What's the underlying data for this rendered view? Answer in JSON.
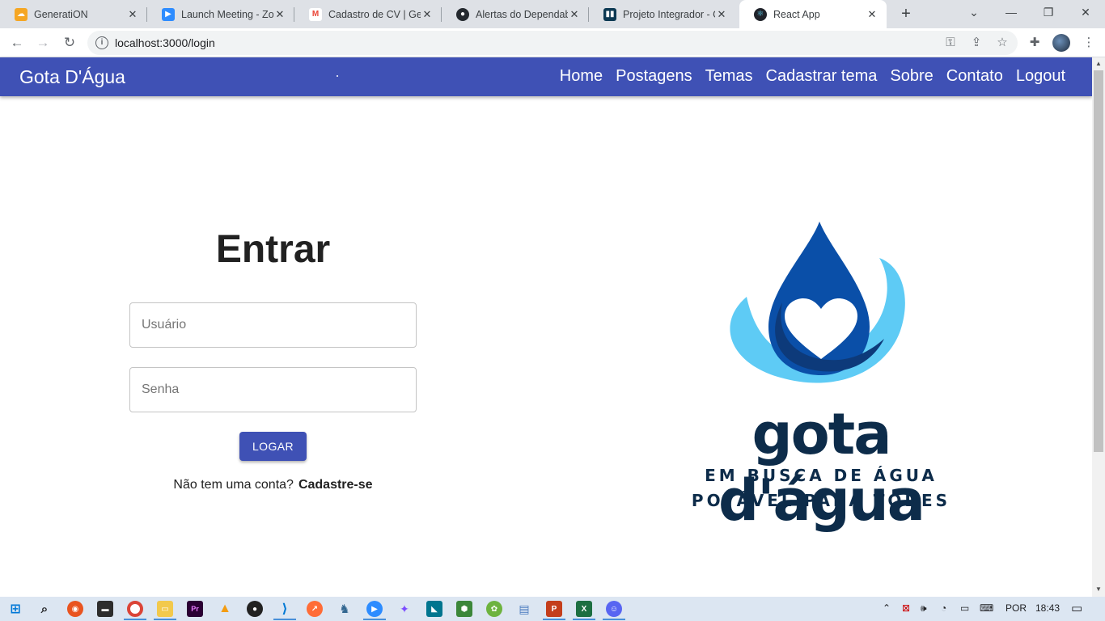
{
  "browser": {
    "tabs": [
      {
        "title": "GeneratiON",
        "icon": "cloud-icon",
        "color": "#f5a623"
      },
      {
        "title": "Launch Meeting - Zoom",
        "icon": "zoom-icon",
        "color": "#2d8cff"
      },
      {
        "title": "Cadastro de CV | GenT",
        "icon": "gmail-icon",
        "color": "#ea4335"
      },
      {
        "title": "Alertas do Dependabot",
        "icon": "github-icon",
        "color": "#24292e"
      },
      {
        "title": "Projeto Integrador - G",
        "icon": "trello-icon",
        "color": "#0079bf"
      },
      {
        "title": "React App",
        "icon": "react-icon",
        "color": "#61dafb"
      }
    ],
    "active_tab": 5,
    "url": "localhost:3000/login"
  },
  "app": {
    "brand": "Gota D'Água",
    "nav": [
      "Home",
      "Postagens",
      "Temas",
      "Cadastrar tema",
      "Sobre",
      "Contato",
      "Logout"
    ],
    "accent": "#3f51b5"
  },
  "login": {
    "title": "Entrar",
    "username_placeholder": "Usuário",
    "password_placeholder": "Senha",
    "button": "LOGAR",
    "no_account": "Não tem uma conta?",
    "signup_link": "Cadastre-se"
  },
  "logo": {
    "name": "gota d'água",
    "tagline_1": "EM BUSCA DE ÁGUA",
    "tagline_2": "POTÁVEL PARA TODES",
    "dark_color": "#0d2c4a",
    "blue_color": "#0a4fa8",
    "light_color": "#5ecbf5"
  },
  "taskbar": {
    "language": "POR",
    "time": "18:43"
  }
}
